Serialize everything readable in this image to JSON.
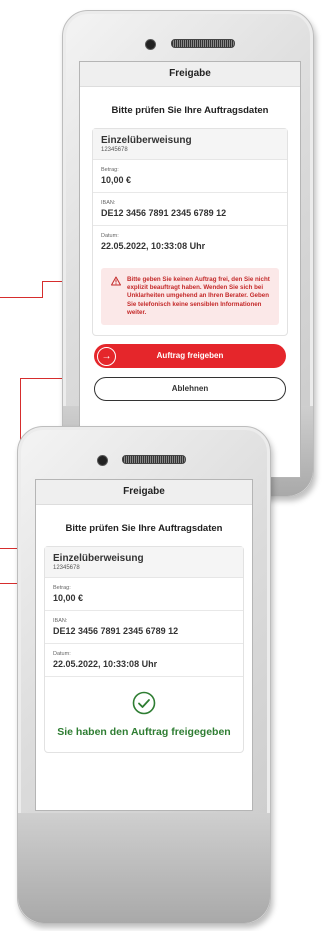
{
  "phone1": {
    "title": "Freigabe",
    "heading": "Bitte prüfen Sie Ihre Auftragsdaten",
    "card": {
      "title": "Einzelüberweisung",
      "account": "12345678",
      "fields": [
        {
          "label": "Betrag:",
          "value": "10,00 €"
        },
        {
          "label": "IBAN:",
          "value": "DE12 3456 7891 2345 6789 12"
        },
        {
          "label": "Datum:",
          "value": "22.05.2022, 10:33:08 Uhr"
        }
      ]
    },
    "warning": "Bitte geben Sie keinen Auftrag frei, den Sie nicht explizit beauftragt haben. Wenden Sie sich bei Unklarheiten umgehend an Ihren Berater. Geben Sie telefonisch keine sensiblen Informationen weiter.",
    "approve_label": "Auftrag freigeben",
    "reject_label": "Ablehnen"
  },
  "phone2": {
    "title": "Freigabe",
    "heading": "Bitte prüfen Sie Ihre Auftragsdaten",
    "card": {
      "title": "Einzelüberweisung",
      "account": "12345678",
      "fields": [
        {
          "label": "Betrag:",
          "value": "10,00 €"
        },
        {
          "label": "IBAN:",
          "value": "DE12 3456 7891 2345 6789 12"
        },
        {
          "label": "Datum:",
          "value": "22.05.2022, 10:33:08 Uhr"
        }
      ]
    },
    "success_message": "Sie haben den Auftrag freigegeben"
  },
  "icons": {
    "warning": "warning-triangle-icon",
    "arrow": "arrow-right-icon",
    "check": "check-circle-icon"
  },
  "colors": {
    "accent": "#e5262b",
    "warning_bg": "#fbe8e8",
    "warning_text": "#c42a2a",
    "success": "#2e7d32"
  }
}
